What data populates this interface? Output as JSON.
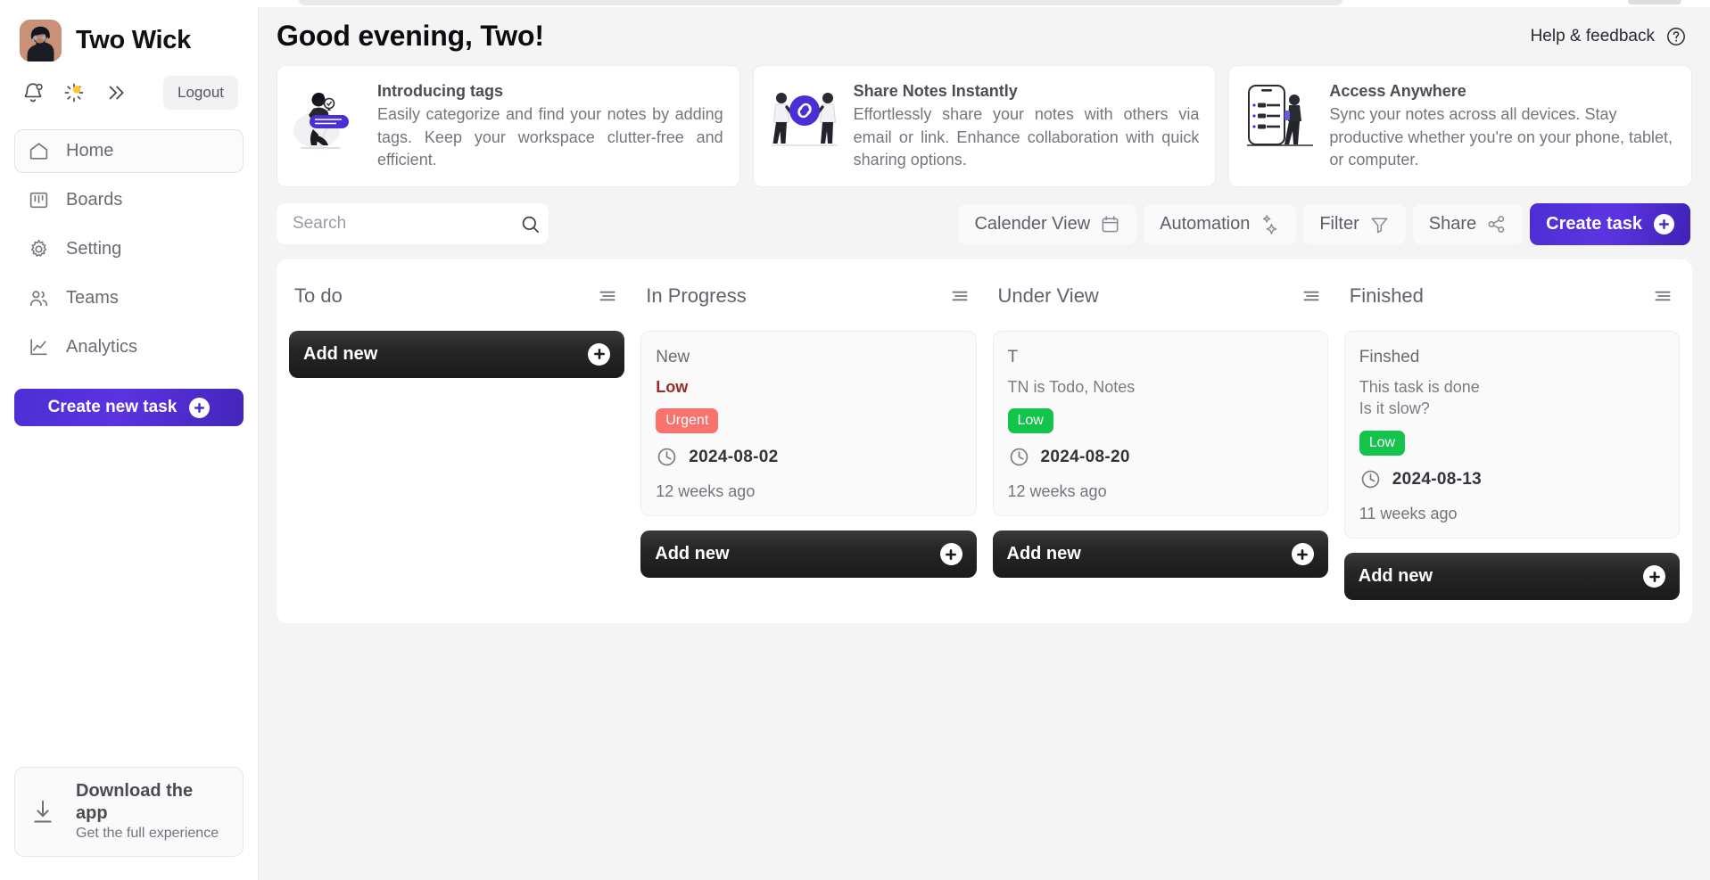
{
  "sidebar": {
    "user": {
      "name": "Two Wick",
      "avatar_icon": "user-avatar"
    },
    "icon_row": {
      "bell": "notification-bell-icon",
      "theme": "theme-sun-icon",
      "expand": "chevron-double-right-icon",
      "logout_label": "Logout"
    },
    "items": [
      {
        "label": "Home",
        "icon": "home-icon",
        "active": true
      },
      {
        "label": "Boards",
        "icon": "boards-icon",
        "active": false
      },
      {
        "label": "Setting",
        "icon": "gear-icon",
        "active": false
      },
      {
        "label": "Teams",
        "icon": "users-icon",
        "active": false
      },
      {
        "label": "Analytics",
        "icon": "chart-line-icon",
        "active": false
      }
    ],
    "create_task_label": "Create new task",
    "download": {
      "title": "Download the app",
      "subtitle": "Get the full experience",
      "icon": "download-icon"
    }
  },
  "header": {
    "greeting": "Good evening, Two!",
    "help_label": "Help & feedback",
    "help_icon": "question-circle-icon"
  },
  "promos": [
    {
      "title": "Introducing tags",
      "desc": "Easily categorize and find your notes by adding tags. Keep your workspace clutter-free and efficient.",
      "illustration": "person-with-tag-illustration",
      "justify": true
    },
    {
      "title": "Share Notes Instantly",
      "desc": "Effortlessly share your notes with others via email or link. Enhance collaboration with quick sharing options.",
      "illustration": "two-people-link-illustration",
      "justify": true
    },
    {
      "title": "Access Anywhere",
      "desc": "Sync your notes across all devices. Stay productive whether you're on your phone, tablet, or computer.",
      "illustration": "phone-sync-illustration",
      "justify": false
    }
  ],
  "toolbar": {
    "search_placeholder": "Search",
    "search_value": "",
    "search_icon": "search-icon",
    "buttons": [
      {
        "label": "Calender View",
        "icon": "calendar-icon"
      },
      {
        "label": "Automation",
        "icon": "sparkles-icon"
      },
      {
        "label": "Filter",
        "icon": "funnel-icon"
      },
      {
        "label": "Share",
        "icon": "share-nodes-icon"
      }
    ],
    "create_task_label": "Create task"
  },
  "board": {
    "add_new_label": "Add new",
    "sort_icon": "sort-lines-icon",
    "clock_icon": "clock-icon",
    "columns": [
      {
        "title": "To do",
        "tasks": []
      },
      {
        "title": "In Progress",
        "tasks": [
          {
            "title": "New",
            "meta": "Low",
            "meta_style": "low-red",
            "badge": "Urgent",
            "badge_color": "#f8736e",
            "date": "2024-08-02",
            "ago": "12 weeks ago"
          }
        ]
      },
      {
        "title": "Under View",
        "tasks": [
          {
            "title": "T",
            "meta": "TN is Todo, Notes",
            "meta_style": "",
            "badge": "Low",
            "badge_color": "#12c44b",
            "date": "2024-08-20",
            "ago": "12 weeks ago"
          }
        ]
      },
      {
        "title": "Finished",
        "tasks": [
          {
            "title": "Finshed",
            "meta": "This task is done\nIs it slow?",
            "meta_style": "",
            "badge": "Low",
            "badge_color": "#12c44b",
            "date": "2024-08-13",
            "ago": "11 weeks ago"
          }
        ]
      }
    ]
  },
  "colors": {
    "accent_purple": "#4c2fd4",
    "badge_urgent": "#f8736e",
    "badge_low": "#12c44b",
    "dark_button": "#1b1b1b",
    "page_bg": "#f4f4f5"
  }
}
